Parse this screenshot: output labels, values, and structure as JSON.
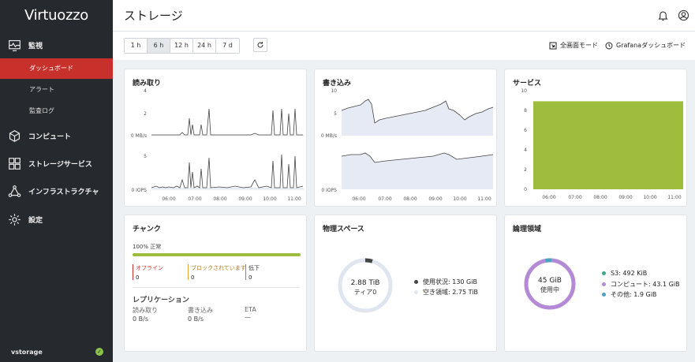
{
  "app": {
    "logo": "Virtuozzo",
    "page_title": "ストレージ",
    "cluster_name": "vstorage"
  },
  "sidebar": {
    "sections": [
      {
        "label": "監視",
        "icon": "monitor-icon"
      },
      {
        "label": "コンピュート",
        "icon": "cube-icon"
      },
      {
        "label": "ストレージサービス",
        "icon": "grid-icon"
      },
      {
        "label": "インフラストラクチャ",
        "icon": "network-icon"
      },
      {
        "label": "設定",
        "icon": "gear-icon"
      }
    ],
    "monitor_items": [
      "ダッシュボード",
      "アラート",
      "監査ログ"
    ],
    "active_item": "ダッシュボード"
  },
  "toolbar": {
    "ranges": [
      "1 h",
      "6 h",
      "12 h",
      "24 h",
      "7 d"
    ],
    "selected_range": "6 h",
    "fullscreen_label": "全画面モード",
    "grafana_label": "Grafanaダッシュボード"
  },
  "read_card": {
    "title": "読み取り",
    "top_ylabels": [
      "4",
      "2",
      "0 MB/s"
    ],
    "bottom_ylabels": [
      "5",
      "0 IOPS"
    ],
    "xticks": [
      "06:00",
      "07:00",
      "08:00",
      "09:00",
      "10:00",
      "11:00"
    ]
  },
  "write_card": {
    "title": "書き込み",
    "top_ylabels": [
      "10",
      "5",
      "0 MB/s"
    ],
    "bottom_ylabels": [
      "0 IOPS"
    ],
    "xticks": [
      "06:00",
      "07:00",
      "08:00",
      "09:00",
      "10:00",
      "11:00"
    ]
  },
  "services_card": {
    "title": "サービス",
    "ylabels": [
      "10",
      "8",
      "6",
      "4",
      "2",
      "0"
    ],
    "xticks": [
      "06:00",
      "07:00",
      "08:00",
      "09:00",
      "10:00",
      "11:00"
    ],
    "value": 9,
    "color": "#9fbd3c"
  },
  "chunks_card": {
    "title": "チャンク",
    "healthy_label": "100% 正常",
    "healthy_fraction": 1.0,
    "status": [
      {
        "label": "オフライン",
        "value": "0",
        "color": "#c8312b"
      },
      {
        "label": "ブロックされています",
        "value": "0",
        "color": "#e6a23c"
      },
      {
        "label": "低下",
        "value": "0",
        "color": "#888888"
      }
    ],
    "replication_title": "レプリケーション",
    "replication": [
      {
        "label": "読み取り",
        "value": "0 B/s"
      },
      {
        "label": "書き込み",
        "value": "0 B/s"
      },
      {
        "label": "ETA",
        "value": "—"
      }
    ]
  },
  "physical_card": {
    "title": "物理スペース",
    "center_value": "2.88 TiB",
    "center_label": "ティア0",
    "used_fraction": 0.045,
    "legend": [
      {
        "label": "使用状況: 130 GiB",
        "color": "#444444"
      },
      {
        "label": "空き領域: 2.75 TiB",
        "color": "#dfe6f0"
      }
    ]
  },
  "logical_card": {
    "title": "論理領域",
    "center_value": "45 GiB",
    "center_label": "使用中",
    "legend": [
      {
        "label": "S3: 492 KiB",
        "color": "#3aa889"
      },
      {
        "label": "コンピュート: 43.1 GiB",
        "color": "#b48ad6"
      },
      {
        "label": "その他: 1.9 GiB",
        "color": "#4aa3c4"
      }
    ],
    "segments": [
      {
        "name": "S3",
        "fraction": 0.01,
        "color": "#3aa889"
      },
      {
        "name": "コンピュート",
        "fraction": 0.958,
        "color": "#b48ad6"
      },
      {
        "name": "その他",
        "fraction": 0.042,
        "color": "#4aa3c4"
      }
    ]
  }
}
